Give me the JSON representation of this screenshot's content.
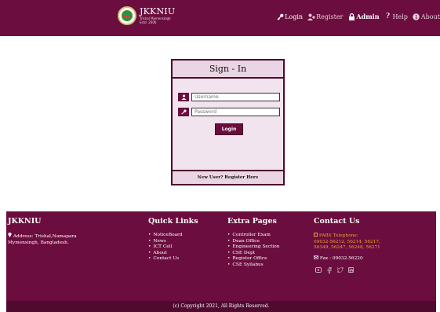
{
  "header": {
    "brand_name": "JKKNIU",
    "brand_sub_line1": "Trishal Mymensingh",
    "brand_sub_line2": "Estd. 2006",
    "nav": [
      {
        "label": "Login",
        "icon": "key-icon"
      },
      {
        "label": "Register",
        "icon": "add-user-icon"
      },
      {
        "label": "Admin",
        "icon": "lock-icon"
      },
      {
        "label": "Help",
        "icon": "question-icon"
      },
      {
        "label": "About",
        "icon": "info-icon"
      }
    ]
  },
  "signin": {
    "title": "Sign - In",
    "username_placeholder": "Username",
    "password_placeholder": "Password",
    "login_label": "Login",
    "register_link": "New User? Register Here"
  },
  "footer": {
    "col1": {
      "title": "JKKNIU",
      "address_line1": "Address: Trishal,Namapara",
      "address_line2": "Mymensingh, Bangladesh."
    },
    "col2": {
      "title": "Quick Links",
      "links": [
        "NoticeBoard",
        "News",
        "ICT Cell",
        "About",
        "Contact Us"
      ]
    },
    "col3": {
      "title": "Extra Pages",
      "links": [
        "Controller Exam",
        "Dean Office",
        "Engineering Section",
        "CSE Dept",
        "Register Office",
        "CSE Syllabus"
      ]
    },
    "col4": {
      "title": "Contact Us",
      "pabx_label": "PABX Telephone:",
      "pabx_line1": "09032-56212, 56214, 56217,",
      "pabx_line2": "56349, 56247, 56248, 56271",
      "fax": "Fax : 09032-56220",
      "social_icons": [
        "youtube-icon",
        "facebook-icon",
        "twitter-icon",
        "linkedin-icon"
      ]
    },
    "copyright": "(c) Copyright 2021, All Rights Reserved."
  },
  "colors": {
    "primary": "#6b0d3e",
    "accent": "#f2a52a",
    "card_bg": "#f1e4ee"
  }
}
